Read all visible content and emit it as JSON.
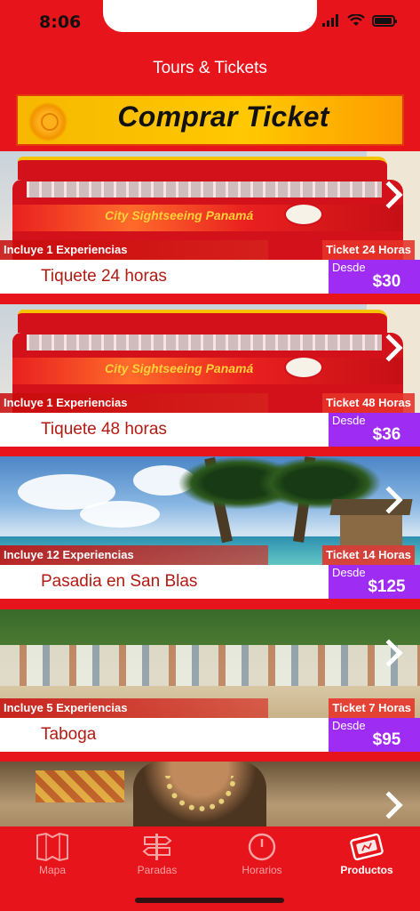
{
  "status": {
    "time": "8:06"
  },
  "nav": {
    "title": "Tours & Tickets"
  },
  "banner": {
    "label": "Comprar Ticket"
  },
  "cards": [
    {
      "left": "Incluye 1 Experiencias",
      "right": "Ticket 24 Horas",
      "title": "Tiquete 24 horas",
      "desde": "Desde",
      "price": "$30",
      "image": "bus"
    },
    {
      "left": "Incluye 1 Experiencias",
      "right": "Ticket 48 Horas",
      "title": "Tiquete 48 horas",
      "desde": "Desde",
      "price": "$36",
      "image": "bus"
    },
    {
      "left": "Incluye 12 Experiencias",
      "right": "Ticket 14 Horas",
      "title": "Pasadia en San Blas",
      "desde": "Desde",
      "price": "$125",
      "image": "beach"
    },
    {
      "left": "Incluye 5 Experiencias",
      "right": "Ticket 7 Horas",
      "title": "Taboga",
      "desde": "Desde",
      "price": "$95",
      "image": "island"
    },
    {
      "left": "",
      "right": "",
      "title": "",
      "desde": "",
      "price": "",
      "image": "people"
    }
  ],
  "tabs": [
    {
      "label": "Mapa",
      "icon": "map-icon",
      "active": false
    },
    {
      "label": "Paradas",
      "icon": "signpost-icon",
      "active": false
    },
    {
      "label": "Horarios",
      "icon": "clock-icon",
      "active": false
    },
    {
      "label": "Productos",
      "icon": "ticket-icon",
      "active": true
    }
  ],
  "colors": {
    "brand_red": "#e8141b",
    "price_purple": "#9f2cf2",
    "title_red": "#b21b12"
  }
}
